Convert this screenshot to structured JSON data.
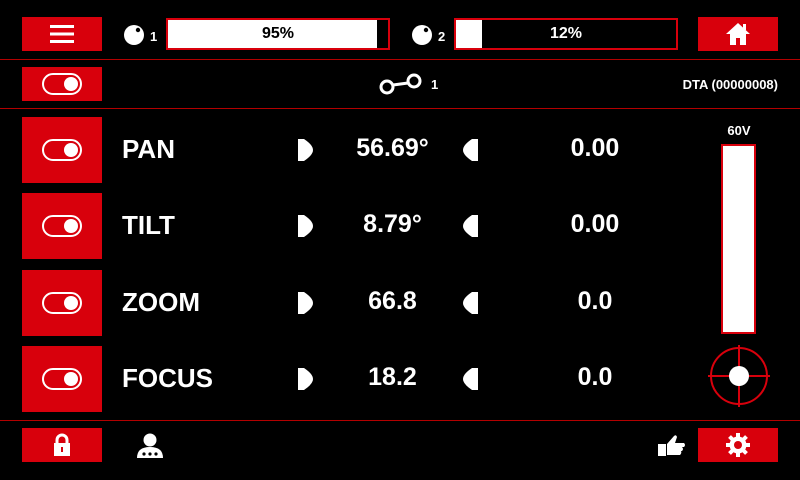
{
  "top": {
    "knob1": {
      "label": "1",
      "percent_label": "95%",
      "level": 0.95
    },
    "knob2": {
      "label": "2",
      "percent_label": "12%",
      "level": 0.12
    }
  },
  "status": {
    "link_count": "1",
    "dta": "DTA (00000008)"
  },
  "axes": [
    {
      "name": "PAN",
      "value": "56.69°",
      "offset": "0.00"
    },
    {
      "name": "TILT",
      "value": "8.79°",
      "offset": "0.00"
    },
    {
      "name": "ZOOM",
      "value": "66.8",
      "offset": "0.0"
    },
    {
      "name": "FOCUS",
      "value": "18.2",
      "offset": "0.0"
    }
  ],
  "voltage": {
    "label": "60V",
    "level": 1.0
  },
  "icons": {
    "menu": "hamburger-menu-icon",
    "home": "home-icon",
    "link": "link-icon",
    "lock": "lock-icon",
    "user": "user-icon",
    "hand": "hand-icon",
    "gear": "gear-icon",
    "crosshair": "crosshair-icon",
    "toggle": "toggle-icon",
    "knob": "knob-icon"
  },
  "colors": {
    "accent": "#d8000c",
    "background": "#000000",
    "text": "#ffffff"
  }
}
